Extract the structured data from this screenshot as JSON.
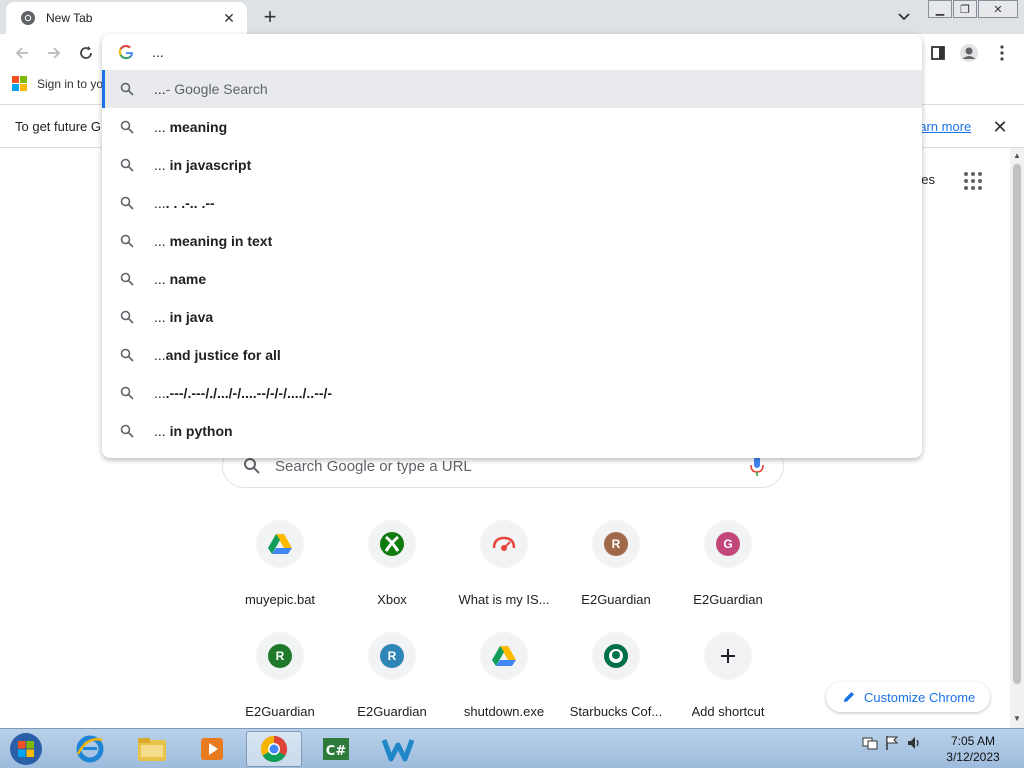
{
  "tab": {
    "title": "New Tab"
  },
  "omnibox": {
    "value": "...",
    "suggestions": [
      {
        "prefix": "...",
        "bold": "",
        "desc": " - Google Search",
        "selected": true
      },
      {
        "prefix": "... ",
        "bold": "meaning",
        "desc": ""
      },
      {
        "prefix": "... ",
        "bold": "in javascript",
        "desc": ""
      },
      {
        "prefix": "...",
        "bold": ". . .-.. .--",
        "desc": ""
      },
      {
        "prefix": "... ",
        "bold": "meaning in text",
        "desc": ""
      },
      {
        "prefix": "... ",
        "bold": "name",
        "desc": ""
      },
      {
        "prefix": "... ",
        "bold": "in java",
        "desc": ""
      },
      {
        "prefix": "...",
        "bold": "and justice for all",
        "desc": ""
      },
      {
        "prefix": "...",
        "bold": ".---/.---/./.../-/....--/-/-/..../..--/-",
        "desc": ""
      },
      {
        "prefix": "... ",
        "bold": "in python",
        "desc": ""
      }
    ]
  },
  "bookmarks": {
    "signin": "Sign in to yo"
  },
  "infobar": {
    "text": "To get future G",
    "link": "earn more"
  },
  "ntp": {
    "images_link": "ges",
    "search_placeholder": "Search Google or type a URL",
    "shortcuts": [
      {
        "label": "muyepic.bat",
        "icon": "google-drive-icon"
      },
      {
        "label": "Xbox",
        "icon": "xbox-icon"
      },
      {
        "label": "What is my IS...",
        "icon": "speedtest-icon"
      },
      {
        "label": "E2Guardian",
        "icon": "letter-icon",
        "letter": "R",
        "color": "#a0694a"
      },
      {
        "label": "E2Guardian",
        "icon": "letter-icon",
        "letter": "G",
        "color": "#c2487a"
      },
      {
        "label": "E2Guardian",
        "icon": "letter-icon",
        "letter": "R",
        "color": "#1e7a2a"
      },
      {
        "label": "E2Guardian",
        "icon": "letter-icon",
        "letter": "R",
        "color": "#2f85b5"
      },
      {
        "label": "shutdown.exe",
        "icon": "google-drive-icon"
      },
      {
        "label": "Starbucks Cof...",
        "icon": "starbucks-icon"
      },
      {
        "label": "Add shortcut",
        "icon": "plus-icon"
      }
    ],
    "customize_label": "Customize Chrome"
  },
  "taskbar": {
    "time": "7:05 AM",
    "date": "3/12/2023"
  },
  "colors": {
    "accent": "#1a73e8",
    "selected_row": "#e8eaed"
  }
}
